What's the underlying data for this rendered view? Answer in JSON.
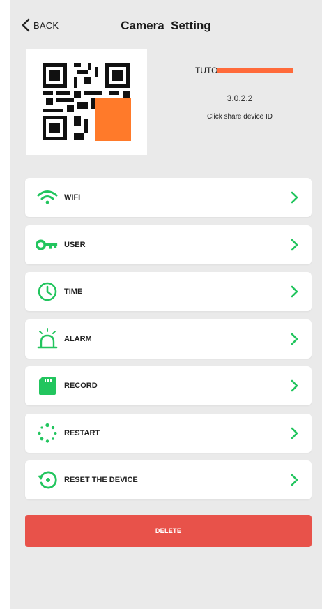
{
  "header": {
    "back_label": "BACK",
    "title": "Camera  Setting"
  },
  "device": {
    "name": "TUTO",
    "version": "3.0.2.2",
    "share_label": "Click share device ID"
  },
  "menu": {
    "items": [
      {
        "label": "WIFI",
        "icon": "wifi-icon"
      },
      {
        "label": "USER",
        "icon": "key-icon"
      },
      {
        "label": "TIME",
        "icon": "clock-icon"
      },
      {
        "label": "ALARM",
        "icon": "alarm-siren-icon"
      },
      {
        "label": "RECORD",
        "icon": "sd-card-icon"
      },
      {
        "label": "RESTART",
        "icon": "restart-dots-icon"
      },
      {
        "label": "RESET THE DEVICE",
        "icon": "reset-icon"
      }
    ]
  },
  "actions": {
    "delete_label": "DELETE"
  },
  "colors": {
    "accent_green": "#22c55e",
    "delete_red": "#e8524a",
    "redaction_orange": "#ff7a2a",
    "background": "#eaeaea"
  }
}
